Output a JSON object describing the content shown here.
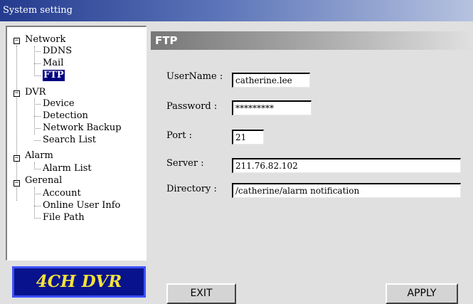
{
  "window": {
    "title": "System setting"
  },
  "tree": {
    "groups": [
      {
        "label": "Network",
        "items": [
          "DDNS",
          "Mail",
          "FTP"
        ]
      },
      {
        "label": "DVR",
        "items": [
          "Device",
          "Detection",
          "Network Backup",
          "Search List"
        ]
      },
      {
        "label": "Alarm",
        "items": [
          "Alarm List"
        ]
      },
      {
        "label": "Gerenal",
        "items": [
          "Account",
          "Online User Info",
          "File Path"
        ]
      }
    ],
    "toggle_symbol": "−",
    "selected": "FTP"
  },
  "logo": {
    "text": "4CH DVR"
  },
  "ftp": {
    "header": "FTP",
    "username_label": "UserName :",
    "username_value": "catherine.lee",
    "password_label": "Password :",
    "password_value": "*********",
    "port_label": "Port :",
    "port_value": "21",
    "server_label": "Server :",
    "server_value": "211.76.82.102",
    "directory_label": "Directory :",
    "directory_value": "/catherine/alarm notification"
  },
  "buttons": {
    "exit": "EXIT",
    "apply": "APPLY"
  },
  "colors": {
    "titlebar": "#243b8e",
    "selection": "#000080",
    "logo_bg": "#08128c",
    "logo_text": "#f2e23a"
  }
}
